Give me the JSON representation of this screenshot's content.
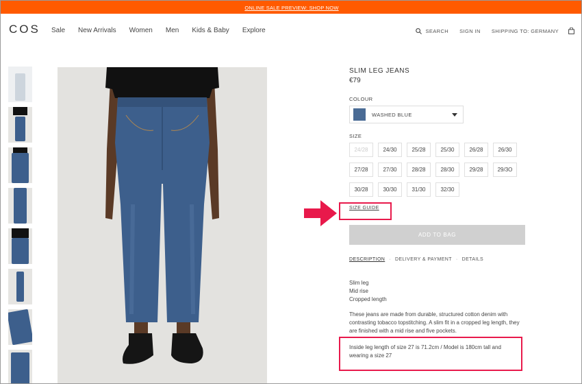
{
  "banner": {
    "text": "ONLINE SALE PREVIEW: SHOP NOW"
  },
  "nav": {
    "logo": "COS",
    "menu": [
      "Sale",
      "New Arrivals",
      "Women",
      "Men",
      "Kids & Baby",
      "Explore"
    ],
    "search": "SEARCH",
    "signin": "SIGN IN",
    "shipping": "SHIPPING TO: GERMANY"
  },
  "product": {
    "name": "SLIM LEG JEANS",
    "price": "€79",
    "colour_label": "COLOUR",
    "colour_value": "WASHED BLUE",
    "size_label": "SIZE",
    "sizes": [
      {
        "label": "24/28",
        "available": false
      },
      {
        "label": "24/30",
        "available": true
      },
      {
        "label": "25/28",
        "available": true
      },
      {
        "label": "25/30",
        "available": true
      },
      {
        "label": "26/28",
        "available": true
      },
      {
        "label": "26/30",
        "available": true
      },
      {
        "label": "27/28",
        "available": true
      },
      {
        "label": "27/30",
        "available": true
      },
      {
        "label": "28/28",
        "available": true
      },
      {
        "label": "28/30",
        "available": true
      },
      {
        "label": "29/28",
        "available": true
      },
      {
        "label": "29/3O",
        "available": true
      },
      {
        "label": "30/28",
        "available": true
      },
      {
        "label": "30/30",
        "available": true
      },
      {
        "label": "31/30",
        "available": true
      },
      {
        "label": "32/30",
        "available": true
      }
    ],
    "size_guide": "SIZE GUIDE",
    "add_to_bag": "ADD TO BAG",
    "tabs": [
      "DESCRIPTION",
      "DELIVERY & PAYMENT",
      "DETAILS"
    ],
    "features": [
      "Slim leg",
      "Mid rise",
      "Cropped length"
    ],
    "description": "These jeans are made from durable, structured cotton denim with contrasting tobacco topstitching. A slim fit in a cropped leg length, they are finished with a mid rise and five pockets.",
    "inseam": "Inside leg length of size 27 is 71.2cm / Model is 180cm tall and wearing a size 27"
  },
  "colors": {
    "banner": "#ff5a00",
    "highlight": "#e8194b",
    "denim": "#3d5f8c",
    "button_disabled": "#d0d0d0"
  },
  "icons": [
    "search-icon",
    "bag-icon",
    "chevron-down-icon",
    "arrow-right-icon"
  ]
}
